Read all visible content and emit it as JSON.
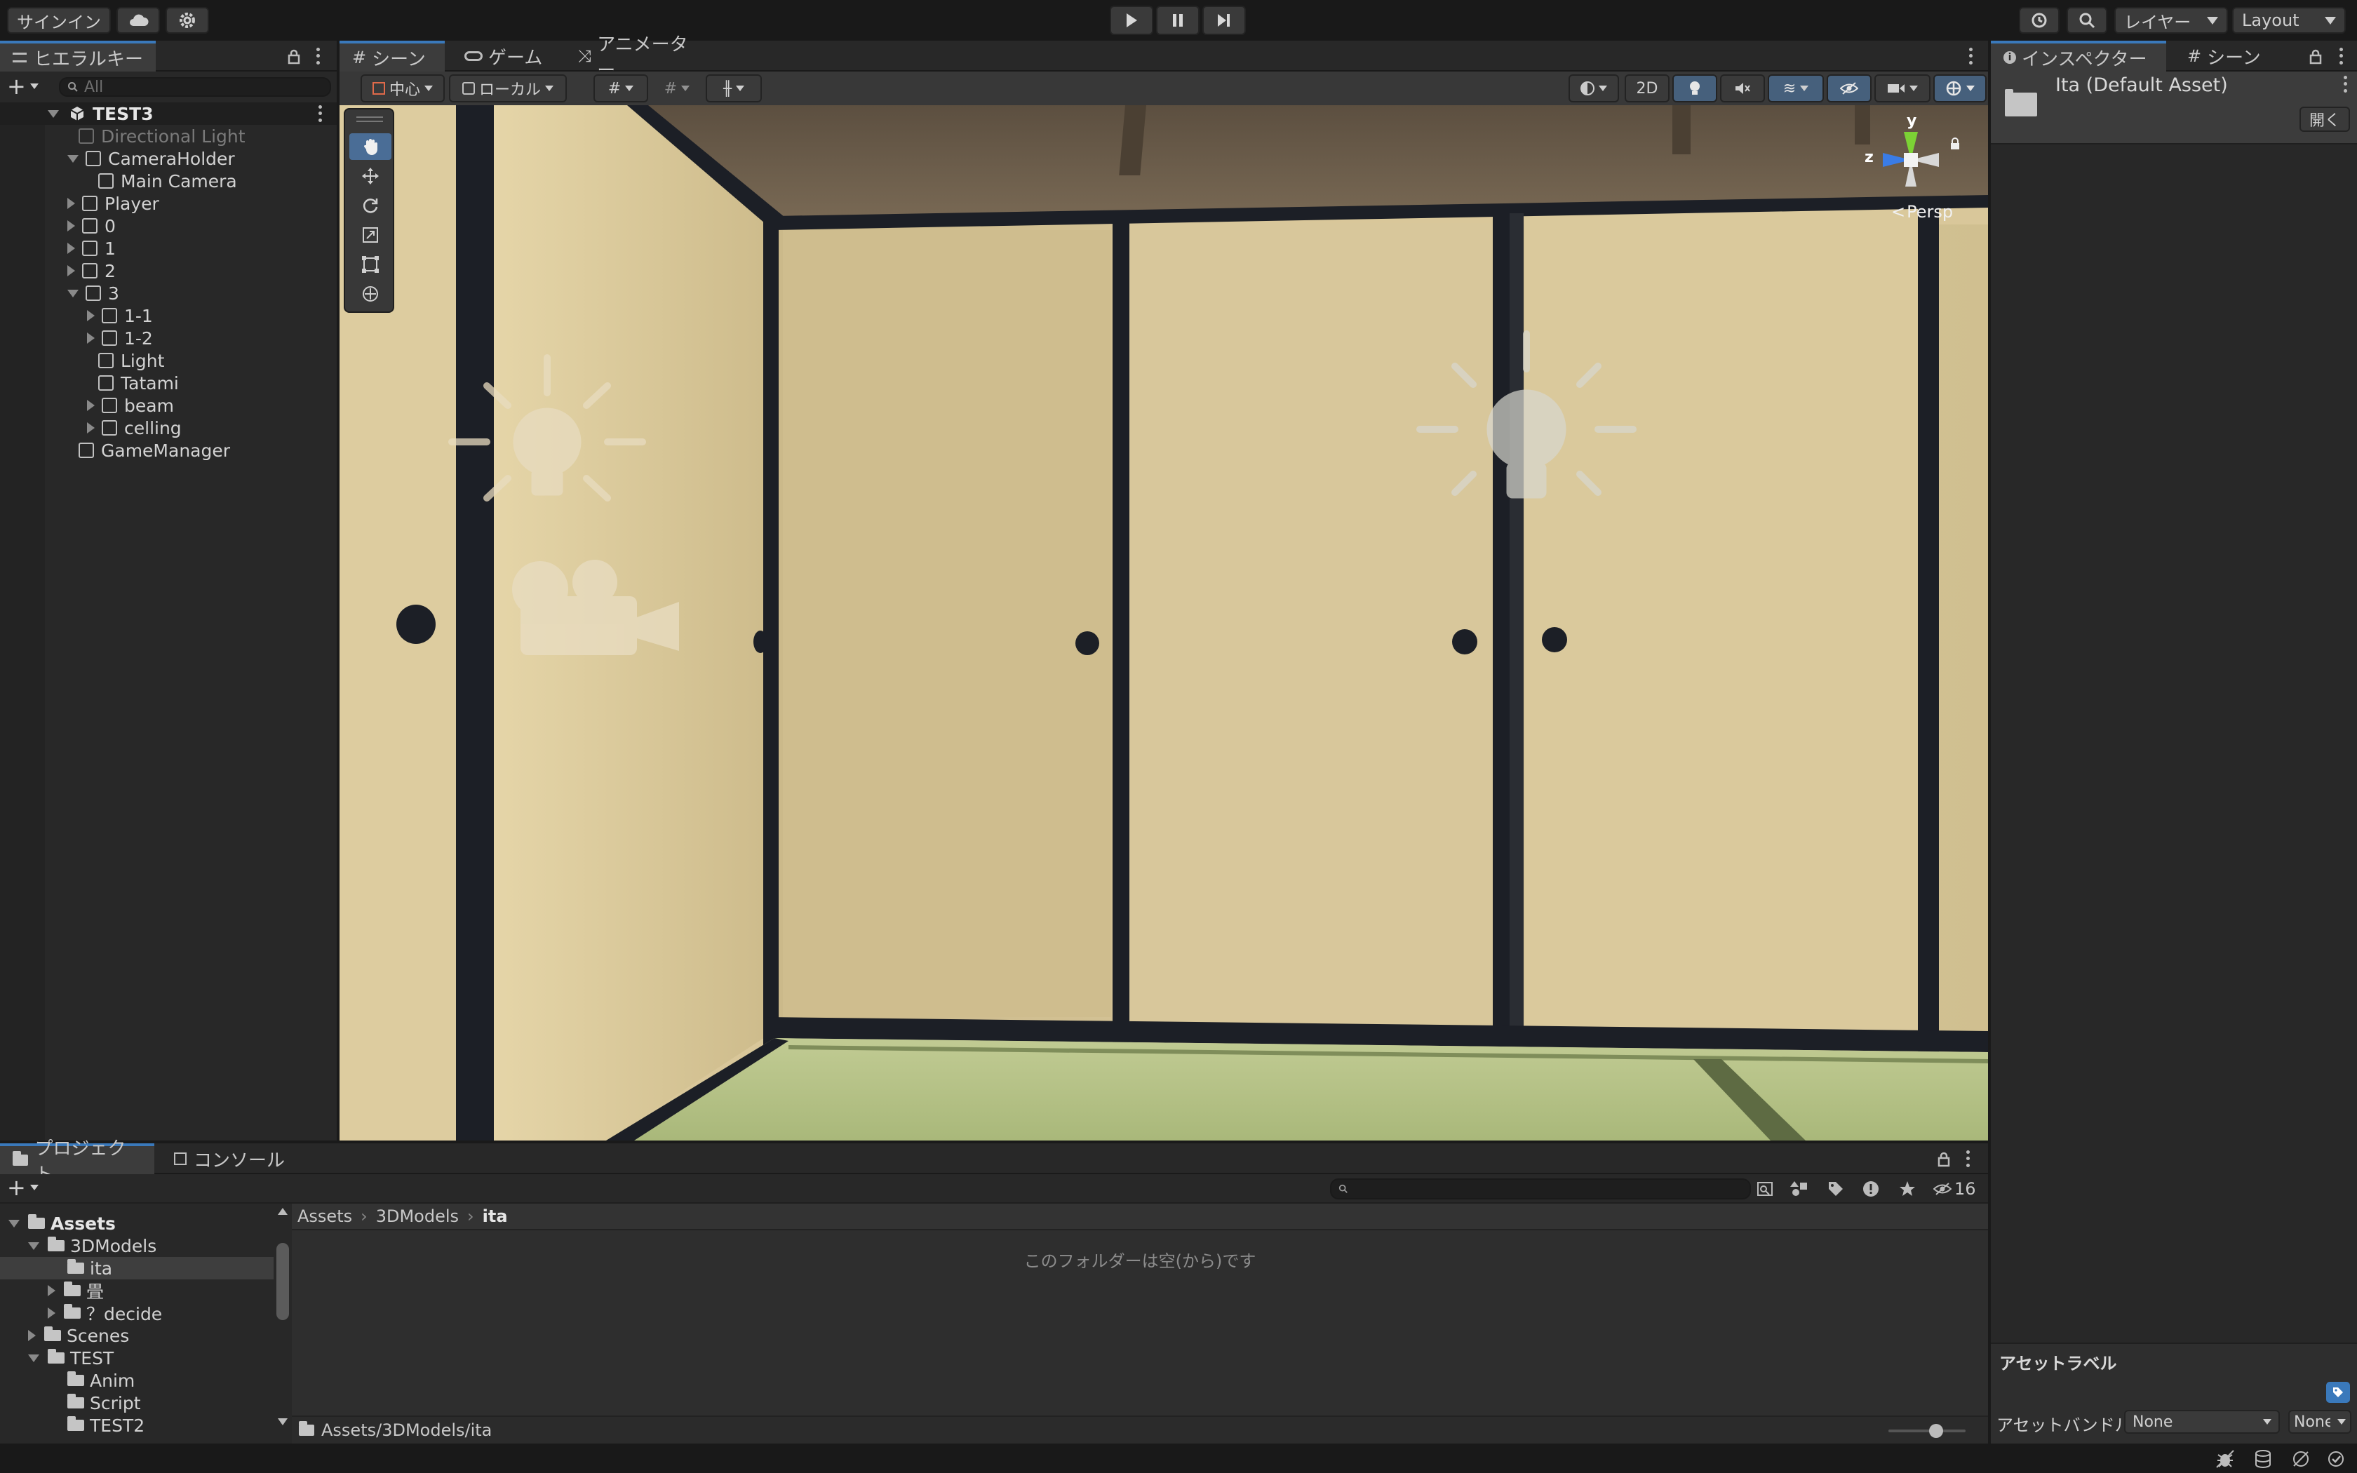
{
  "toolbar": {
    "signin": "サインイン",
    "layers": "レイヤー",
    "layout": "Layout"
  },
  "hierarchy": {
    "tab": "ヒエラルキー",
    "search_placeholder": "All",
    "scene": "TEST3",
    "items": [
      {
        "label": "Directional Light",
        "depth": 1,
        "expander": "none",
        "dim": true
      },
      {
        "label": "CameraHolder",
        "depth": 1,
        "expander": "open"
      },
      {
        "label": "Main Camera",
        "depth": 2,
        "expander": "none"
      },
      {
        "label": "Player",
        "depth": 1,
        "expander": "closed"
      },
      {
        "label": "0",
        "depth": 1,
        "expander": "closed"
      },
      {
        "label": "1",
        "depth": 1,
        "expander": "closed"
      },
      {
        "label": "2",
        "depth": 1,
        "expander": "closed"
      },
      {
        "label": "3",
        "depth": 1,
        "expander": "open"
      },
      {
        "label": "1-1",
        "depth": 2,
        "expander": "closed"
      },
      {
        "label": "1-2",
        "depth": 2,
        "expander": "closed"
      },
      {
        "label": "Light",
        "depth": 2,
        "expander": "none"
      },
      {
        "label": "Tatami",
        "depth": 2,
        "expander": "none"
      },
      {
        "label": "beam",
        "depth": 2,
        "expander": "closed"
      },
      {
        "label": "celling",
        "depth": 2,
        "expander": "closed"
      },
      {
        "label": "GameManager",
        "depth": 1,
        "expander": "none"
      }
    ]
  },
  "scene_view": {
    "tabs": [
      "シーン",
      "ゲーム",
      "アニメーター"
    ],
    "pivot": "中心",
    "space": "ローカル",
    "mode_2d": "2D",
    "persp": "Persp",
    "axis_y": "y",
    "axis_z": "z"
  },
  "inspector": {
    "tabs": [
      "インスペクター",
      "シーン"
    ],
    "asset_name": "Ita (Default Asset)",
    "open_button": "開く",
    "asset_label": "アセットラベル",
    "asset_bundle": "アセットバンドル",
    "bundle_value": "None",
    "variant_value": "None"
  },
  "project": {
    "tabs": [
      "プロジェクト",
      "コンソール"
    ],
    "count": "16",
    "breadcrumb": [
      "Assets",
      "3DModels",
      "ita"
    ],
    "empty_message": "このフォルダーは空(から)です",
    "path": "Assets/3DModels/ita",
    "tree": [
      {
        "label": "Assets",
        "depth": 0,
        "expander": "open",
        "bold": true
      },
      {
        "label": "3DModels",
        "depth": 1,
        "expander": "open"
      },
      {
        "label": "ita",
        "depth": 2,
        "expander": "none",
        "selected": true
      },
      {
        "label": "畳",
        "depth": 2,
        "expander": "closed"
      },
      {
        "label": "？decide",
        "depth": 2,
        "expander": "closed"
      },
      {
        "label": "Scenes",
        "depth": 1,
        "expander": "closed"
      },
      {
        "label": "TEST",
        "depth": 1,
        "expander": "open"
      },
      {
        "label": "Anim",
        "depth": 2,
        "expander": "none"
      },
      {
        "label": "Script",
        "depth": 2,
        "expander": "none"
      },
      {
        "label": "TEST2",
        "depth": 2,
        "expander": "none"
      }
    ]
  },
  "colors": {
    "accent": "#3a79bb",
    "panel": "#282828",
    "shoji": "#d9c79a",
    "tatami": "#b7c487",
    "frame": "#1c1f26"
  }
}
